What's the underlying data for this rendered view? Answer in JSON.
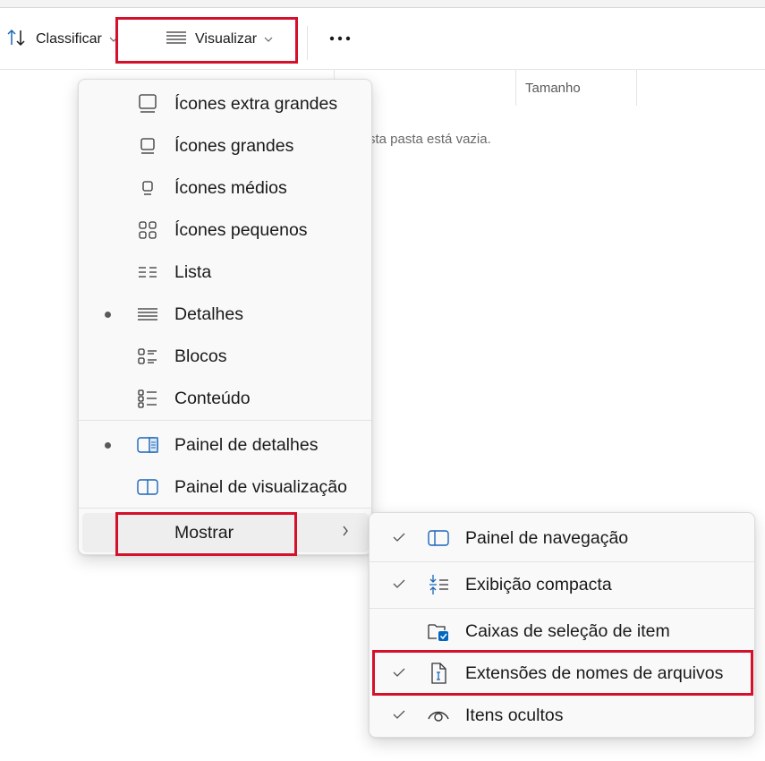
{
  "toolbar": {
    "sort_label": "Classificar",
    "view_label": "Visualizar",
    "more_label": "•••"
  },
  "file_list": {
    "size_header": "Tamanho",
    "empty_message": "Esta pasta está vazia."
  },
  "view_menu": {
    "items": [
      {
        "label": "Ícones extra grandes",
        "icon": "extra-large-icons-icon",
        "selected": false
      },
      {
        "label": "Ícones grandes",
        "icon": "large-icons-icon",
        "selected": false
      },
      {
        "label": "Ícones médios",
        "icon": "medium-icons-icon",
        "selected": false
      },
      {
        "label": "Ícones pequenos",
        "icon": "small-icons-icon",
        "selected": false
      },
      {
        "label": "Lista",
        "icon": "list-icon",
        "selected": false
      },
      {
        "label": "Detalhes",
        "icon": "details-icon",
        "selected": true
      },
      {
        "label": "Blocos",
        "icon": "tiles-icon",
        "selected": false
      },
      {
        "label": "Conteúdo",
        "icon": "content-icon",
        "selected": false
      }
    ],
    "panes": [
      {
        "label": "Painel de detalhes",
        "icon": "details-pane-icon",
        "selected": true
      },
      {
        "label": "Painel de visualização",
        "icon": "preview-pane-icon",
        "selected": false
      }
    ],
    "show_label": "Mostrar"
  },
  "show_menu": {
    "items": [
      {
        "label": "Painel de navegação",
        "icon": "navigation-pane-icon",
        "checked": true
      },
      {
        "label": "Exibição compacta",
        "icon": "compact-view-icon",
        "checked": true
      },
      {
        "label": "Caixas de seleção de item",
        "icon": "item-checkboxes-icon",
        "checked": false
      },
      {
        "label": "Extensões de nomes de arquivos",
        "icon": "file-extensions-icon",
        "checked": true
      },
      {
        "label": "Itens ocultos",
        "icon": "hidden-items-icon",
        "checked": true
      }
    ]
  },
  "colors": {
    "highlight": "#d4102a",
    "accent": "#0067c0"
  }
}
